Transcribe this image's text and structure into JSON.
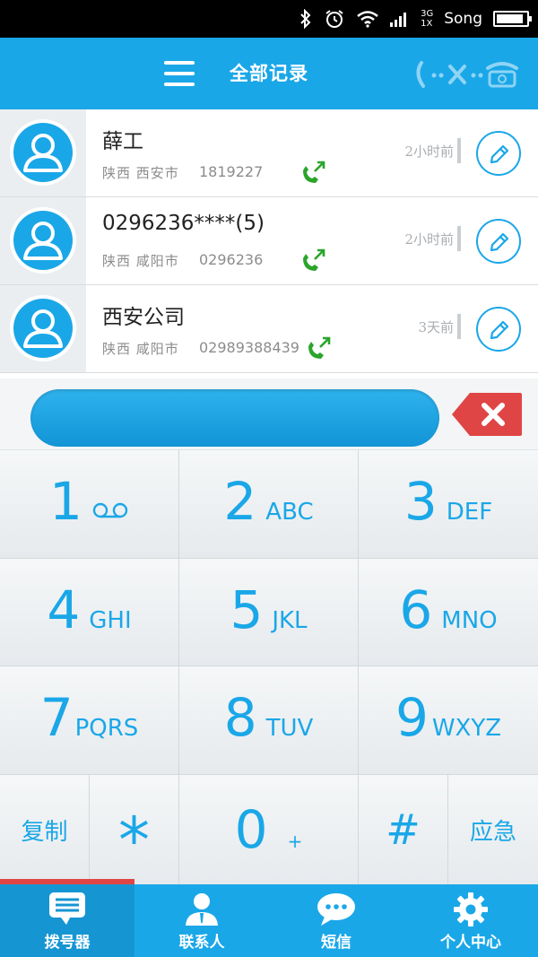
{
  "status_bar": {
    "network_top": "3G",
    "network_bottom": "1X",
    "carrier": "Song",
    "battery_level": 0.9
  },
  "header": {
    "title": "全部记录"
  },
  "call_log": [
    {
      "name": "薛工",
      "location": "陕西 西安市",
      "number": "1819227",
      "time": "2小时前"
    },
    {
      "name": "0296236****(5)",
      "location": "陕西 咸阳市",
      "number": "0296236",
      "time": "2小时前"
    },
    {
      "name": "西安公司",
      "location": "陕西 咸阳市",
      "number": "02989388439",
      "time": "3天前"
    }
  ],
  "dial_input": {
    "value": "",
    "placeholder": ""
  },
  "keypad": {
    "keys": [
      {
        "digit": "1",
        "letters": ""
      },
      {
        "digit": "2",
        "letters": "ABC"
      },
      {
        "digit": "3",
        "letters": "DEF"
      },
      {
        "digit": "4",
        "letters": "GHI"
      },
      {
        "digit": "5",
        "letters": "JKL"
      },
      {
        "digit": "6",
        "letters": "MNO"
      },
      {
        "digit": "7",
        "letters": "PQRS"
      },
      {
        "digit": "8",
        "letters": "TUV"
      },
      {
        "digit": "9",
        "letters": "WXYZ"
      }
    ],
    "copy_label": "复制",
    "star": "*",
    "zero": "0",
    "zero_sub": "+",
    "hash": "#",
    "emergency_label": "应急"
  },
  "bottom_nav": [
    {
      "label": "拨号器",
      "icon": "dialer-icon"
    },
    {
      "label": "联系人",
      "icon": "contacts-icon"
    },
    {
      "label": "短信",
      "icon": "sms-icon"
    },
    {
      "label": "个人中心",
      "icon": "gear-icon"
    }
  ],
  "colors": {
    "brand": "#1aa7e8",
    "call_green": "#2aa52a",
    "danger": "#e04545"
  }
}
